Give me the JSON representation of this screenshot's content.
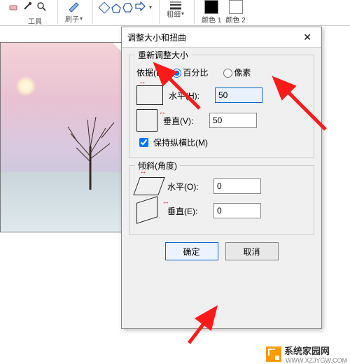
{
  "ribbon": {
    "eraser_icon": "eraser",
    "picker_icon": "color-picker",
    "zoom_icon": "magnifier",
    "brush_label": "刷子",
    "tools_label": "工具",
    "stroke_label": "粗细",
    "color1_label": "颜色 1",
    "color2_label": "颜色 2"
  },
  "dialog": {
    "title": "调整大小和扭曲",
    "resize": {
      "legend": "重新调整大小",
      "by_label": "依据(B):",
      "percent_label": "百分比",
      "pixel_label": "像素",
      "horizontal_label": "水平(H):",
      "horizontal_value": "50",
      "vertical_label": "垂直(V):",
      "vertical_value": "50",
      "maintain_aspect": "保持纵横比(M)"
    },
    "skew": {
      "legend": "倾斜(角度)",
      "horizontal_label": "水平(O):",
      "horizontal_value": "0",
      "vertical_label": "垂直(E):",
      "vertical_value": "0"
    },
    "ok": "确定",
    "cancel": "取消"
  },
  "watermark": {
    "name": "系统家园网",
    "url": "WWW.XZJYGW.COM"
  }
}
